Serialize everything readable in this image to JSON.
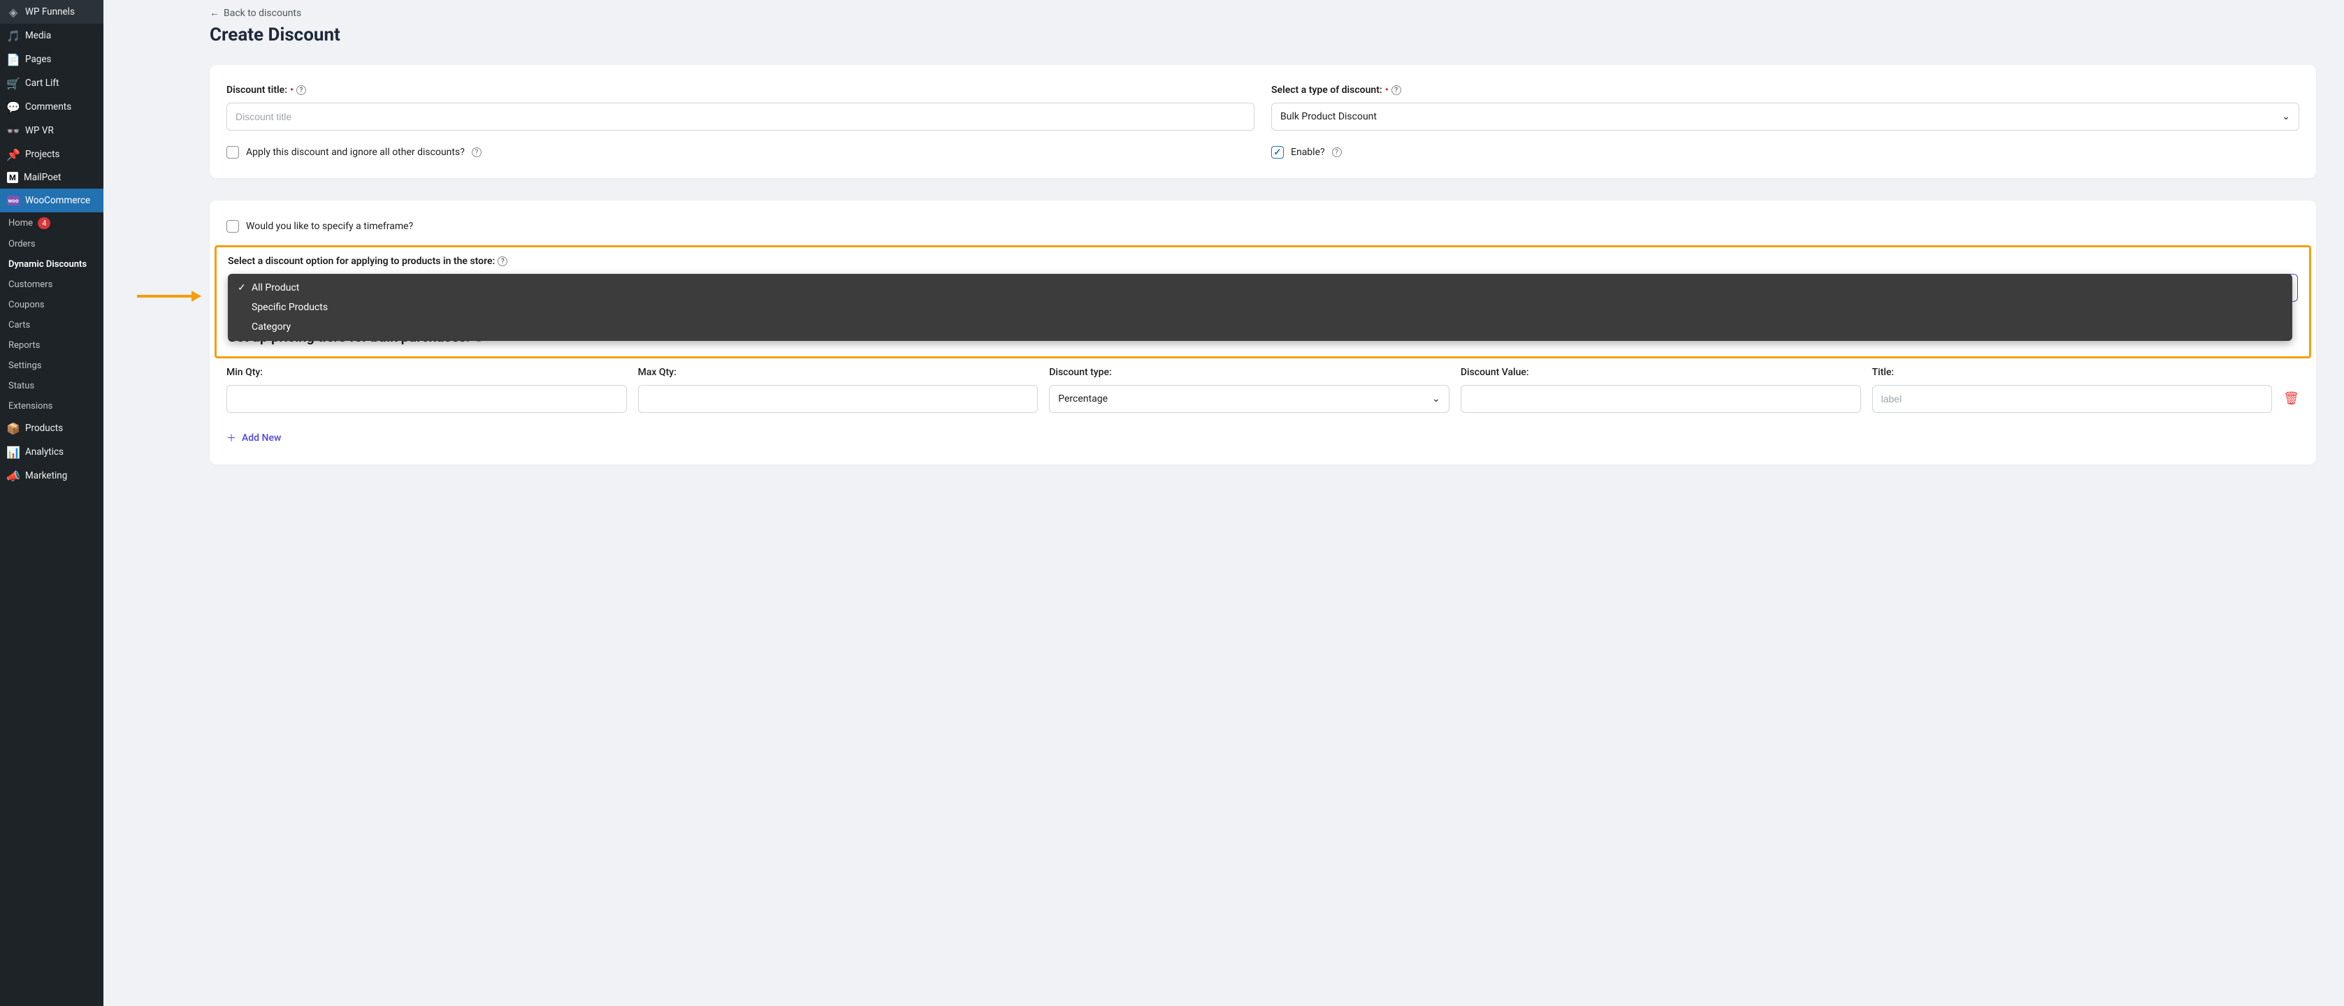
{
  "sidebar": {
    "items": [
      {
        "label": "WP Funnels",
        "icon": "funnel"
      },
      {
        "label": "Media",
        "icon": "media"
      },
      {
        "label": "Pages",
        "icon": "pages"
      },
      {
        "label": "Cart Lift",
        "icon": "cart"
      },
      {
        "label": "Comments",
        "icon": "comment"
      },
      {
        "label": "WP VR",
        "icon": "vr"
      },
      {
        "label": "Projects",
        "icon": "pin"
      },
      {
        "label": "MailPoet",
        "icon": "mail"
      },
      {
        "label": "WooCommerce",
        "icon": "woo"
      },
      {
        "label": "Products",
        "icon": "products"
      },
      {
        "label": "Analytics",
        "icon": "analytics"
      },
      {
        "label": "Marketing",
        "icon": "marketing"
      }
    ],
    "sub": {
      "home": "Home",
      "home_badge": "4",
      "orders": "Orders",
      "dynamic_discounts": "Dynamic Discounts",
      "customers": "Customers",
      "coupons": "Coupons",
      "carts": "Carts",
      "reports": "Reports",
      "settings": "Settings",
      "status": "Status",
      "extensions": "Extensions"
    }
  },
  "back_link": "Back to discounts",
  "page_title": "Create Discount",
  "form": {
    "title_label": "Discount title:",
    "title_placeholder": "Discount title",
    "type_label": "Select a type of discount:",
    "type_value": "Bulk Product Discount",
    "apply_ignore": "Apply this discount and ignore all other discounts?",
    "enable": "Enable?",
    "timeframe": "Would you like to specify a timeframe?",
    "select_option_label": "Select a discount option for applying to products in the store:",
    "dropdown_options": [
      "All Product",
      "Specific Products",
      "Category"
    ],
    "pricing_tiers_title": "Set up pricing tiers for bulk purchases:",
    "tier": {
      "min_qty": "Min Qty:",
      "max_qty": "Max Qty:",
      "discount_type": "Discount type:",
      "discount_type_value": "Percentage",
      "discount_value": "Discount Value:",
      "title": "Title:",
      "title_placeholder": "label"
    },
    "add_new": "Add New"
  }
}
